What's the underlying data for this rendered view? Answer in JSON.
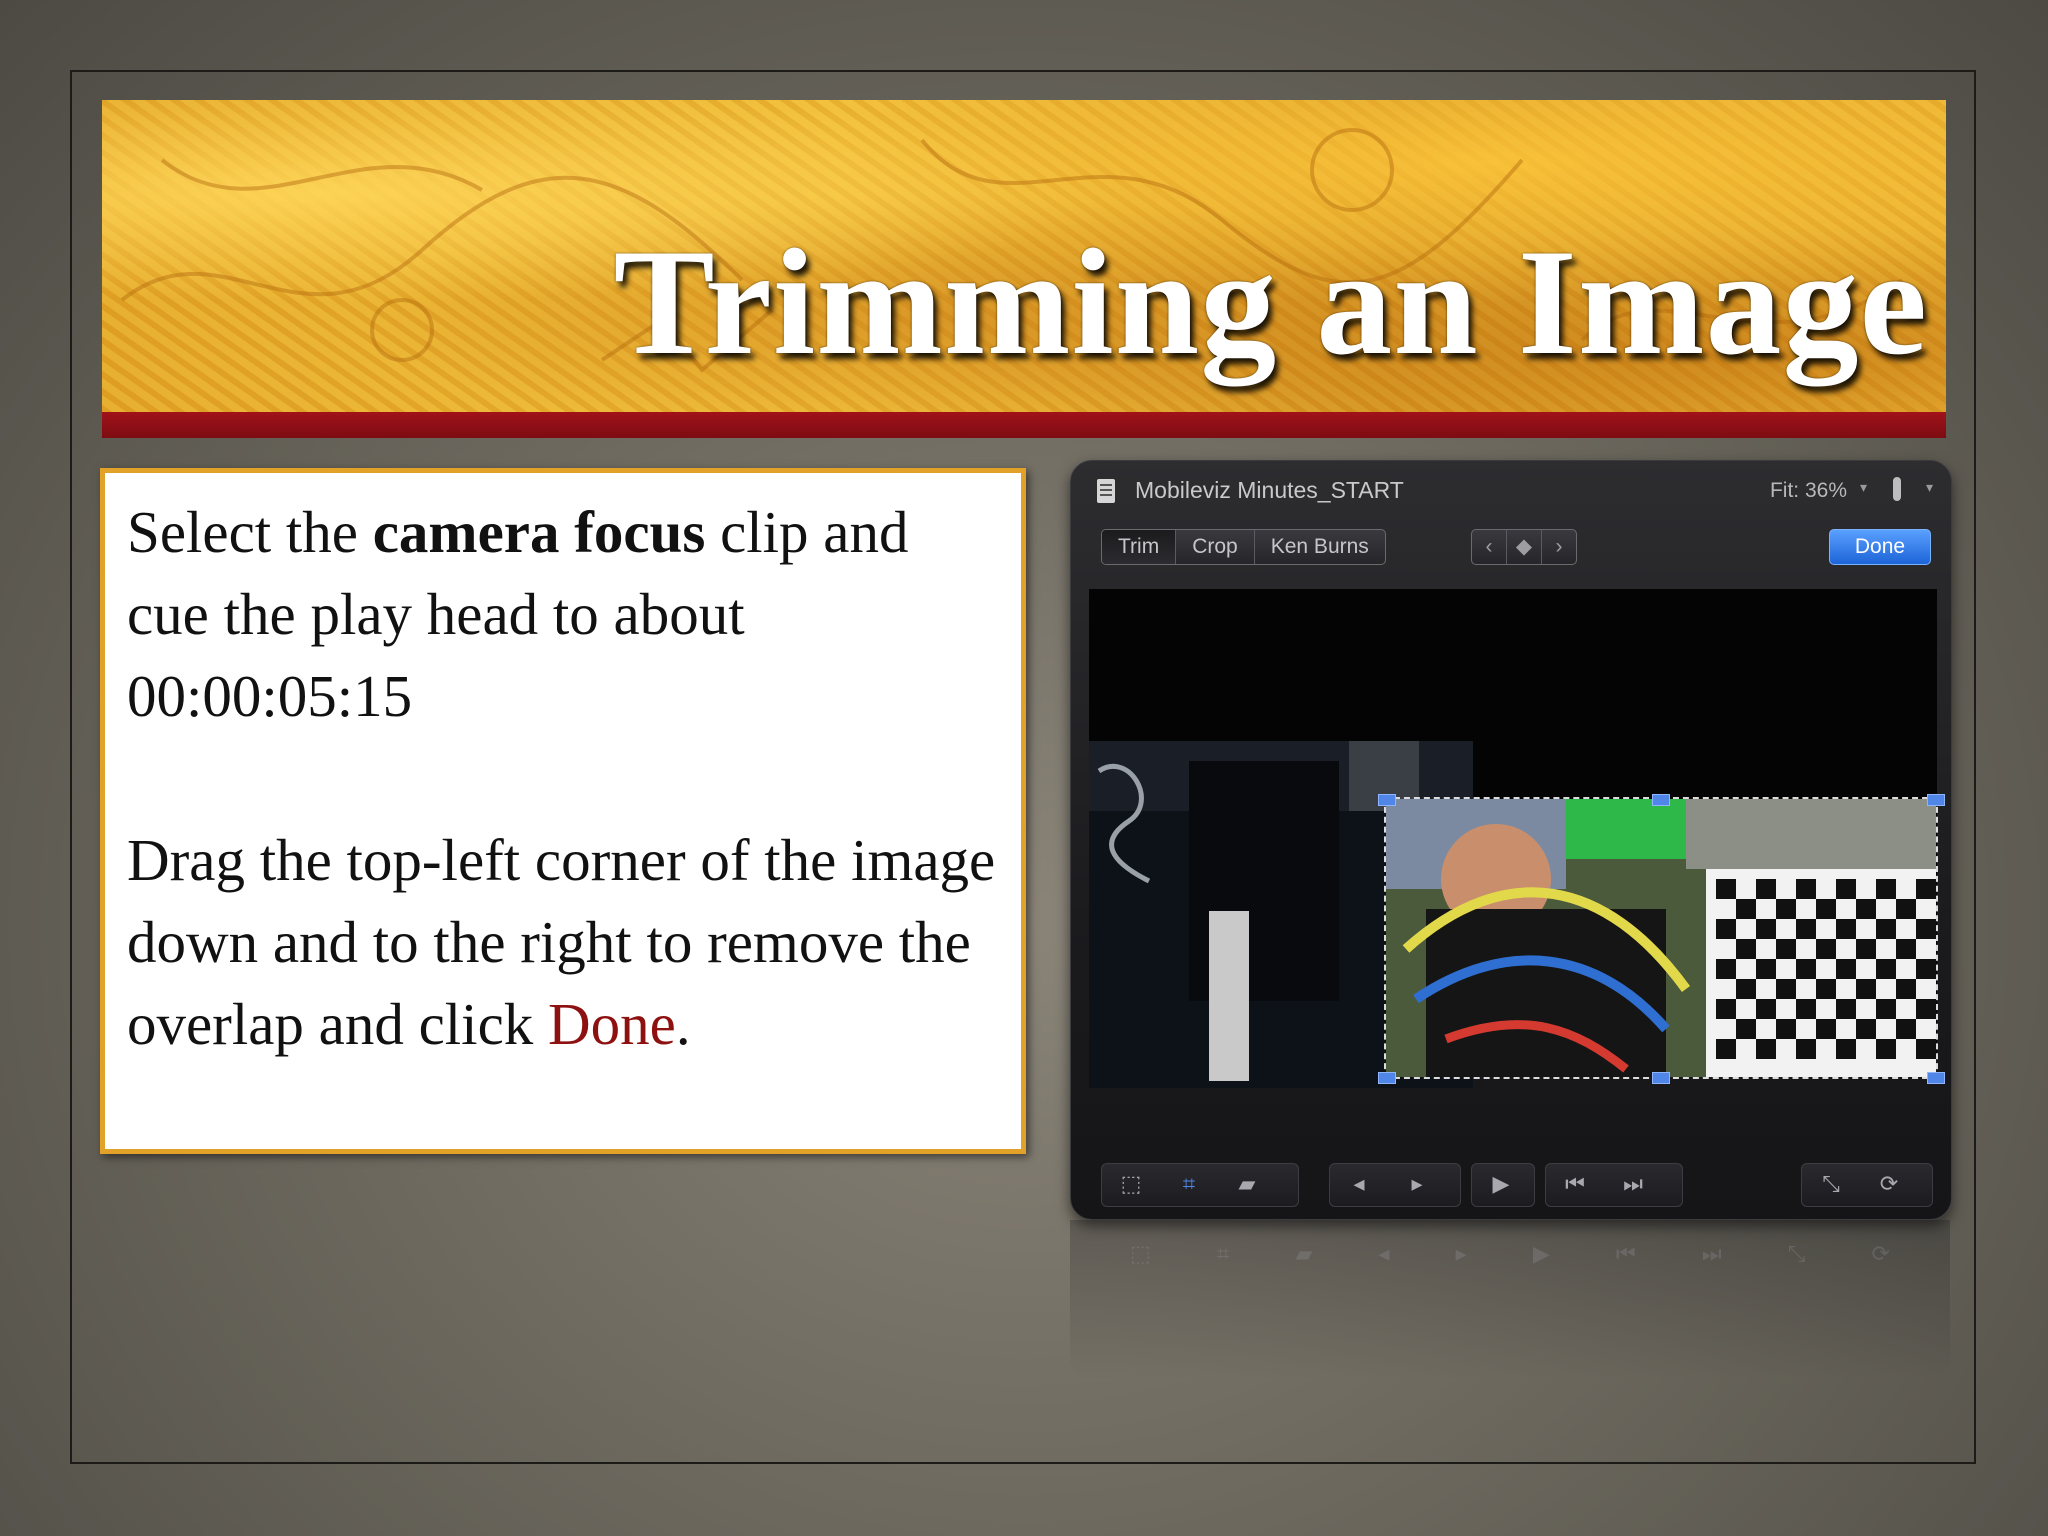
{
  "slide": {
    "title": "Trimming an Image",
    "paragraph1": {
      "t1": "Select the ",
      "bold": "camera focus",
      "t2": " clip and cue the play head to about 00:00:05:15"
    },
    "paragraph2": {
      "t1": "Drag the top-left corner of the image down and to the right to remove the overlap and click ",
      "done": "Done",
      "t2": "."
    }
  },
  "app": {
    "document_title": "Mobileviz Minutes_START",
    "fit_label": "Fit: 36%",
    "tabs": [
      "Trim",
      "Crop",
      "Ken Burns"
    ],
    "done_label": "Done"
  },
  "colors": {
    "banner_bar": "#8e0f15",
    "done_text": "#8e1111",
    "done_button": "#2f7df0",
    "textbox_border": "#e2a22a"
  },
  "icons": {
    "titlebar": [
      "document-icon",
      "thermometer-icon"
    ],
    "segment_nav": [
      "chevron-left-icon",
      "keyframe-icon",
      "chevron-right-icon"
    ],
    "playback": [
      "frame-icon",
      "crop-icon",
      "distort-icon",
      "step-back-icon",
      "step-forward-icon",
      "play-icon",
      "go-to-start-icon",
      "go-to-end-icon",
      "fullscreen-icon",
      "loop-icon"
    ]
  }
}
